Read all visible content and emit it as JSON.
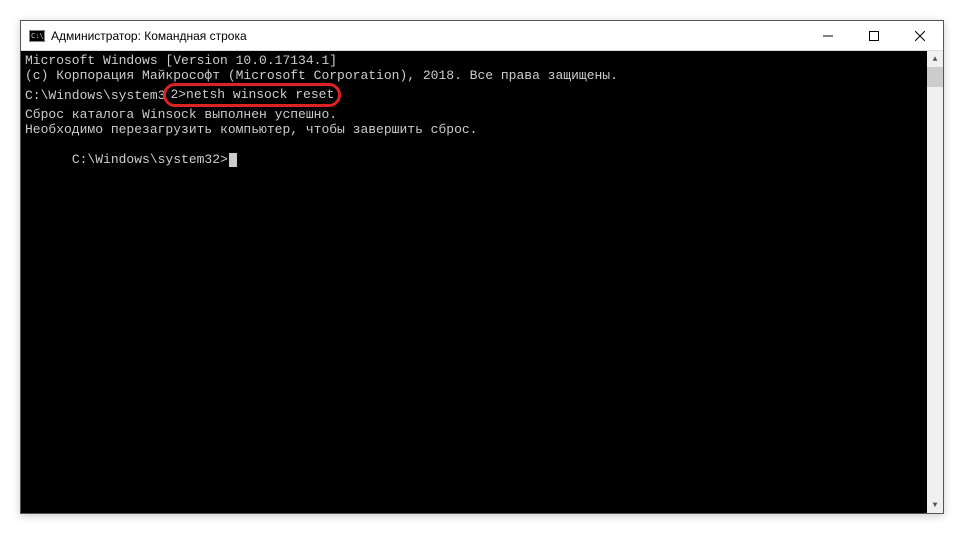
{
  "titlebar": {
    "icon_glyph": "C:\\",
    "title": "Администратор: Командная строка"
  },
  "console": {
    "line1": "Microsoft Windows [Version 10.0.17134.1]",
    "line2": "(c) Корпорация Майкрософт (Microsoft Corporation), 2018. Все права защищены.",
    "blank1": "",
    "prompt1_prefix": "C:\\Windows\\system3",
    "prompt1_highlighted": "2>netsh winsock reset",
    "blank2": "",
    "result1": "Сброс каталога Winsock выполнен успешно.",
    "result2": "Необходимо перезагрузить компьютер, чтобы завершить сброс.",
    "blank3": "",
    "blank4": "",
    "prompt2": "C:\\Windows\\system32>"
  },
  "scrollbar": {
    "up": "▲",
    "down": "▼"
  }
}
